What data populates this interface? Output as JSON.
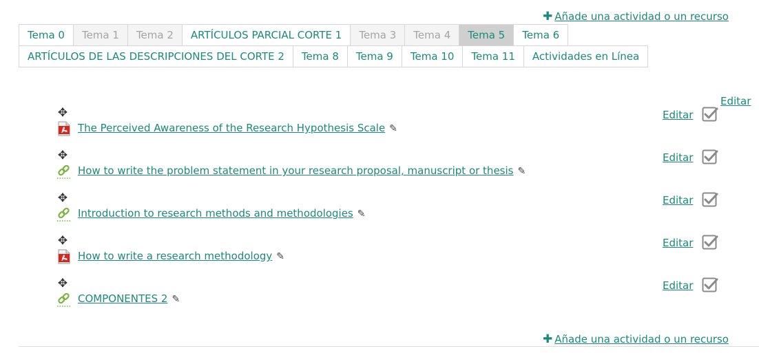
{
  "add_activity_label": "Añade una actividad o un recurso",
  "tabs_row1": [
    {
      "label": "Tema 0",
      "state": "normal"
    },
    {
      "label": "Tema 1",
      "state": "disabled"
    },
    {
      "label": "Tema 2",
      "state": "disabled"
    },
    {
      "label": "ARTÍCULOS PARCIAL CORTE 1",
      "state": "normal"
    },
    {
      "label": "Tema 3",
      "state": "disabled"
    },
    {
      "label": "Tema 4",
      "state": "disabled"
    },
    {
      "label": "Tema 5",
      "state": "selected"
    },
    {
      "label": "Tema 6",
      "state": "normal"
    }
  ],
  "tabs_row2": [
    {
      "label": "ARTÍCULOS DE LAS DESCRIPCIONES DEL CORTE 2",
      "state": "normal"
    },
    {
      "label": "Tema 8",
      "state": "normal"
    },
    {
      "label": "Tema 9",
      "state": "normal"
    },
    {
      "label": "Tema 10",
      "state": "normal"
    },
    {
      "label": "Tema 11",
      "state": "normal"
    },
    {
      "label": "Actividades en Línea",
      "state": "normal"
    }
  ],
  "section_edit_label": "Editar",
  "activities": [
    {
      "name": "The Perceived Awareness of the Research Hypothesis Scale",
      "type": "pdf",
      "edit_label": "Editar",
      "completed": true
    },
    {
      "name": "How to write the problem statement in your research proposal, manuscript or thesis",
      "type": "url",
      "edit_label": "Editar",
      "completed": true
    },
    {
      "name": "Introduction to research methods and methodologies",
      "type": "url",
      "edit_label": "Editar",
      "completed": true
    },
    {
      "name": "How to write a research methodology",
      "type": "pdf",
      "edit_label": "Editar",
      "completed": true
    },
    {
      "name": "COMPONENTES 2",
      "type": "url",
      "edit_label": "Editar",
      "completed": true
    }
  ],
  "colors": {
    "link": "#1a8a7a",
    "tab_selected_bg": "#cfcfcf",
    "tab_disabled_text": "#a4a4a4",
    "pdf_red": "#d8261c",
    "url_green": "#7bb53e"
  }
}
